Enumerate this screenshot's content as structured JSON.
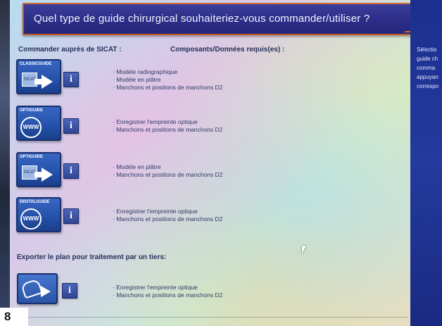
{
  "title": "Quel type de guide chirurgical souhaiteriez-vous commander/utiliser ?",
  "section_order_label": "Commander auprès de SICAT :",
  "section_requirements_label": "Composants/Données requis(es) :",
  "section_export_label": "Exporter le plan pour traitement par un tiers:",
  "rows": [
    {
      "brand": "CLASSICGUIDE",
      "badge": "SICAT",
      "info": "i",
      "requirements": [
        "· Modèle radiographique",
        "· Modèle en plâtre",
        "· Manchons et positions de manchons D2"
      ]
    },
    {
      "brand": "OPTIGUIDE",
      "badge": "WWW",
      "info": "i",
      "requirements": [
        "· Enregistrer l'empreinte optique",
        "· Manchons et positions de manchons D2"
      ]
    },
    {
      "brand": "OPTIGUIDE",
      "badge": "SICAT",
      "info": "i",
      "requirements": [
        "· Modèle en plâtre",
        "· Manchons et positions de manchons D2"
      ]
    },
    {
      "brand": "DIGITALGUIDE",
      "badge": "WWW",
      "info": "i",
      "requirements": [
        "· Enregistrer l'empreinte optique",
        "· Manchons et positions de manchons D2"
      ]
    }
  ],
  "export_row": {
    "info": "i",
    "requirements": [
      "· Enregistrer l'empreinte optique",
      "· Manchons et positions de manchons D2"
    ]
  },
  "side_panel": [
    "Sélectio",
    "guide ch",
    "comma",
    "appuyan",
    "correspo"
  ],
  "figure_number": "8",
  "colors": {
    "title_bar": "#2a2c86",
    "title_border": "#c55a2a",
    "side_panel": "#1c2f8e",
    "icon_blue": "#2450a8"
  },
  "icons": {
    "info": "info-icon",
    "export": "export-tray-icon",
    "arrow": "arrow-right-icon",
    "globe": "globe-www-icon"
  }
}
